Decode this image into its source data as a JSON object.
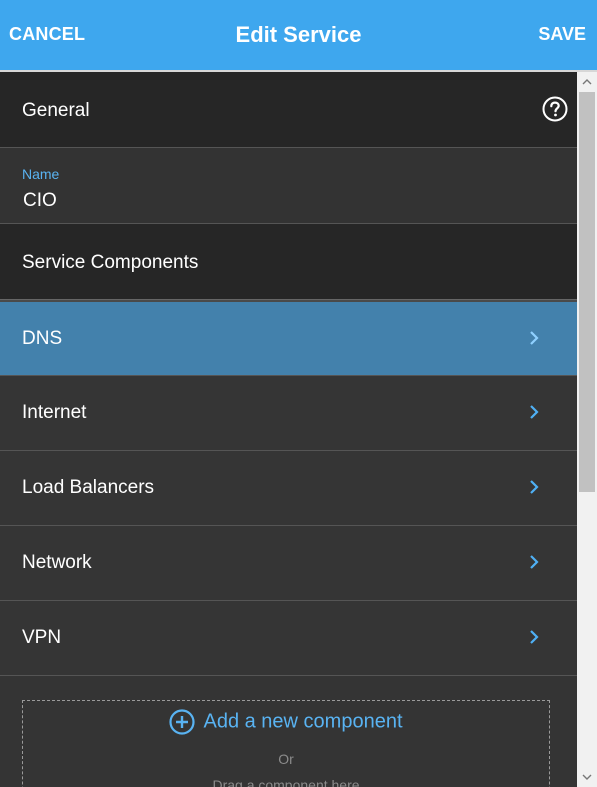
{
  "header": {
    "cancel_label": "CANCEL",
    "title": "Edit Service",
    "save_label": "SAVE"
  },
  "general": {
    "title": "General",
    "name_label": "Name",
    "name_value": "CIO"
  },
  "components": {
    "title": "Service Components",
    "items": [
      {
        "label": "DNS",
        "active": true
      },
      {
        "label": "Internet"
      },
      {
        "label": "Load Balancers"
      },
      {
        "label": "Network"
      },
      {
        "label": "VPN"
      }
    ]
  },
  "dropzone": {
    "add_label": "Add a new component",
    "or_label": "Or",
    "drag_label": "Drag a component here"
  },
  "colors": {
    "accent": "#3ea7ee",
    "active_row": "#4381ac",
    "link": "#59b3f2"
  }
}
